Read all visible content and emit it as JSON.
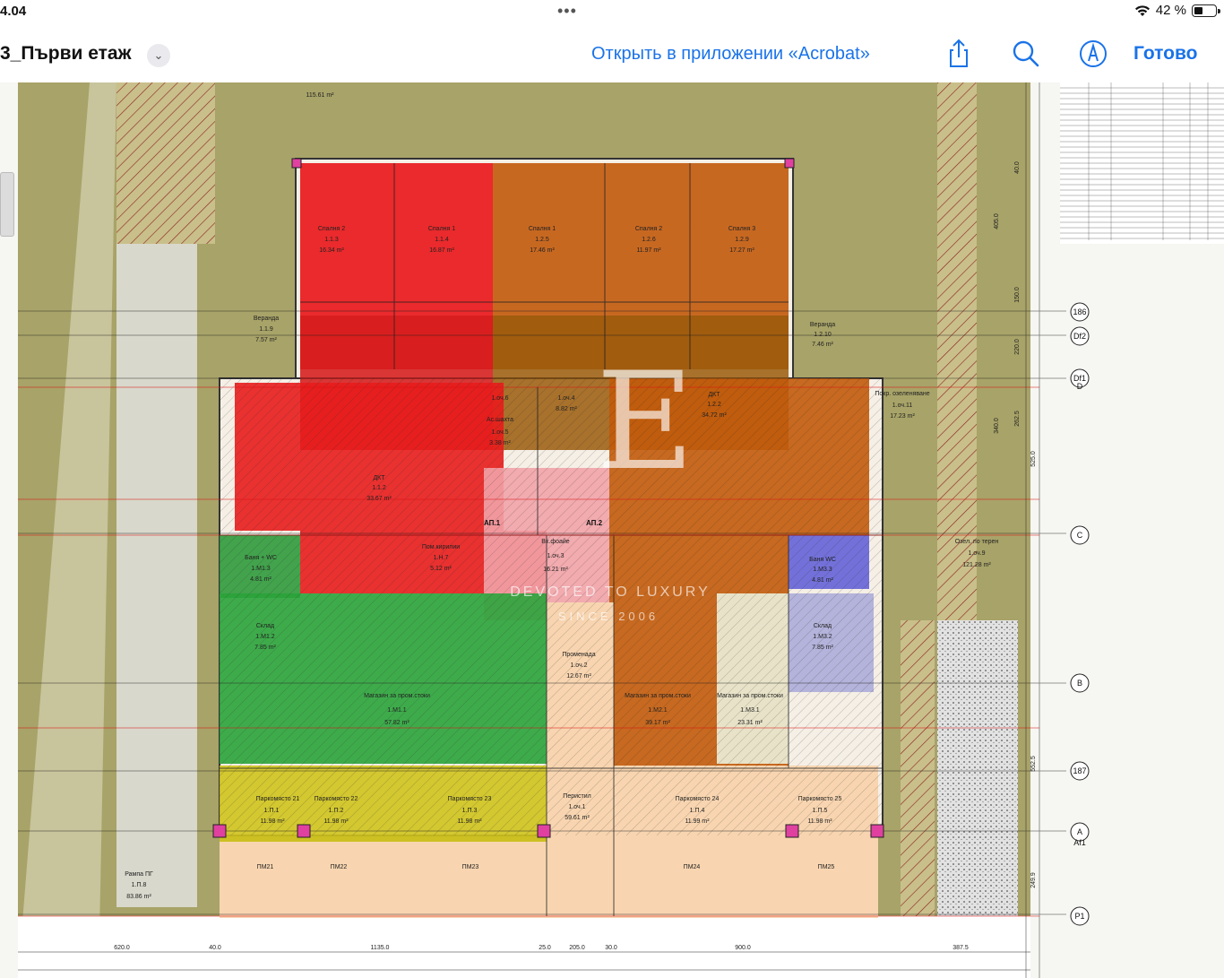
{
  "status_bar": {
    "time": "4.04",
    "dots": "•••",
    "battery_text": "42 %",
    "battery_level": 0.42
  },
  "nav": {
    "title": "3_Първи етаж",
    "open_in": "Открыть в приложении «Acrobat»",
    "done": "Готово",
    "icons": [
      "share-icon",
      "search-icon",
      "markup-pen-icon",
      "chevron-down-icon",
      "wifi-icon",
      "battery-icon"
    ]
  },
  "plan": {
    "rooms": {
      "bedroom2": {
        "name": "Спалня 2",
        "code": "1.1.3",
        "area": "16.34 m²"
      },
      "bedroom1": {
        "name": "Спалня 1",
        "code": "1.1.4",
        "area": "16.87 m²"
      },
      "bedroom_a": {
        "name": "Спалня 1",
        "code": "1.2.5",
        "area": "17.46 m²"
      },
      "bedroom_b": {
        "name": "Спалня 2",
        "code": "1.2.6",
        "area": "11.97 m²"
      },
      "bedroom3": {
        "name": "Спалня 3",
        "code": "1.2.9",
        "area": "17.27 m²"
      },
      "veranda_l": {
        "name": "Веранда",
        "code": "1.1.9",
        "area": "7.57 m²"
      },
      "veranda_r": {
        "name": "Веранда",
        "code": "1.2.10",
        "area": "7.46 m²"
      },
      "dkt_l": {
        "name": "ДКТ",
        "code": "1.1.2",
        "area": "33.67 m²"
      },
      "dkt_r": {
        "name": "ДКТ",
        "code": "1.2.2",
        "area": "34.72 m²"
      },
      "shaft": {
        "name": "Ас.шахта",
        "code": "1.оч.5",
        "area": "3.38 m²"
      },
      "stairs": {
        "code": "1.оч.4",
        "area": "8.82 m²"
      },
      "elev": {
        "code": "1.оч.6"
      },
      "hall": {
        "name": "Пом.кирилии",
        "code": "1.Н.7",
        "area": "5.12 m²"
      },
      "foyer": {
        "name": "Вх.фоайе",
        "code": "1.оч.3",
        "area": "16.21 m²"
      },
      "bath_l": {
        "name": "Баня + WC",
        "code": "1.М1.3",
        "area": "4.81 m²"
      },
      "bath_r": {
        "name": "Баня WC",
        "code": "1.М3.3",
        "area": "4.81 m²"
      },
      "store_l": {
        "name": "Склад",
        "code": "1.М1.2",
        "area": "7.85 m²"
      },
      "store_r": {
        "name": "Склад",
        "code": "1.М3.2",
        "area": "7.85 m²"
      },
      "shop_l": {
        "name": "Магазин за пром.стоки",
        "code": "1.М1.1",
        "area": "57.82 m²"
      },
      "shop_m": {
        "name": "Магазин за пром.стоки",
        "code": "1.М2.1",
        "area": "39.17 m²"
      },
      "shop_r": {
        "name": "Магазин за пром.стоки",
        "code": "1.М3.1",
        "area": "23.31 m²"
      },
      "promenade": {
        "name": "Променада",
        "code": "1.оч.2",
        "area": "12.67 m²"
      },
      "peristyle": {
        "name": "Перистил",
        "code": "1.оч.1",
        "area": "59.61 m²"
      },
      "green_roof": {
        "name": "Покр. озеленяване",
        "code": "1.оч.11",
        "area": "17.23 m²"
      },
      "green_ground": {
        "name": "Озел. по терен",
        "code": "1.оч.9",
        "area": "121.28 m²"
      },
      "ramp": {
        "name": "Рампа ПГ",
        "code": "1.П.8",
        "area": "83.86 m²"
      },
      "top_area": {
        "area": "115.61 m²"
      }
    },
    "parking": [
      {
        "name": "Паркомясто 21",
        "code": "1.П.1",
        "area": "11.98 m²",
        "tag": "ПМ21"
      },
      {
        "name": "Паркомясто 22",
        "code": "1.П.2",
        "area": "11.98 m²",
        "tag": "ПМ22"
      },
      {
        "name": "Паркомясто 23",
        "code": "1.П.3",
        "area": "11.98 m²",
        "tag": "ПМ23"
      },
      {
        "name": "Паркомясто 24",
        "code": "1.П.4",
        "area": "11.99 m²",
        "tag": "ПМ24"
      },
      {
        "name": "Паркомясто 25",
        "code": "1.П.5",
        "area": "11.98 m²",
        "tag": "ПМ25"
      }
    ],
    "apartments": [
      "АП.1",
      "АП.2"
    ],
    "axes": [
      "186",
      "Df2",
      "Df1",
      "D",
      "C",
      "B",
      "187",
      "A",
      "Af1",
      "P1"
    ],
    "bottom_dims": [
      "620.0",
      "1135.0",
      "205.0",
      "900.0",
      "387.5",
      "40.0",
      "25.0",
      "30.0"
    ],
    "right_dims": [
      "40.0",
      "405.0",
      "150.0",
      "220.0",
      "340.0",
      "262.5",
      "525.0",
      "552.5",
      "249.9"
    ],
    "watermark_letter": "E",
    "watermark_name": "DEVOTED TO LUXURY",
    "watermark_since": "SINCE 2006"
  }
}
